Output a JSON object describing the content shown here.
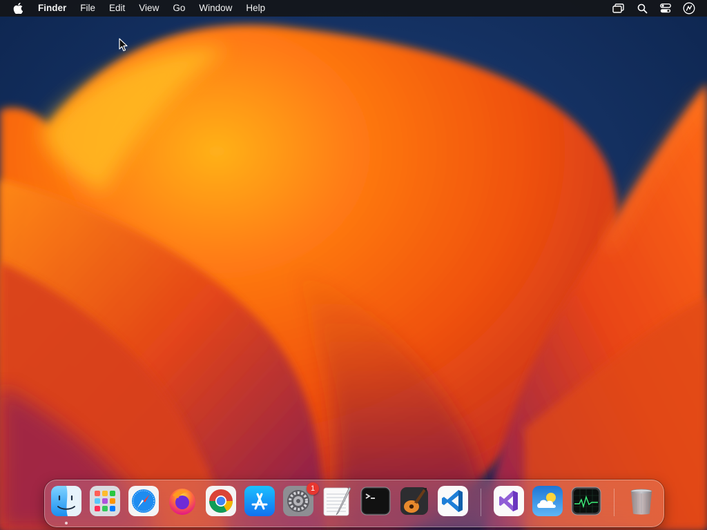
{
  "menubar": {
    "app_name": "Finder",
    "items": [
      "File",
      "Edit",
      "View",
      "Go",
      "Window",
      "Help"
    ],
    "status_icons": [
      "screen-mirroring-icon",
      "spotlight-search-icon",
      "control-center-icon",
      "siri-icon"
    ]
  },
  "wallpaper": {
    "name": "macOS Ventura",
    "colors": {
      "sky": "#0e2a55",
      "orange": "#f25a10",
      "yellow": "#ffb11a",
      "magenta": "#8d1f5a"
    }
  },
  "dock": {
    "apps": [
      {
        "name": "Finder",
        "icon": "finder-icon",
        "running": true
      },
      {
        "name": "Launchpad",
        "icon": "launchpad-icon"
      },
      {
        "name": "Safari",
        "icon": "safari-icon"
      },
      {
        "name": "Firefox",
        "icon": "firefox-icon"
      },
      {
        "name": "Google Chrome",
        "icon": "chrome-icon"
      },
      {
        "name": "App Store",
        "icon": "app-store-icon"
      },
      {
        "name": "System Settings",
        "icon": "system-settings-icon",
        "badge": "1"
      },
      {
        "name": "TextEdit",
        "icon": "textedit-icon"
      },
      {
        "name": "Terminal",
        "icon": "terminal-icon"
      },
      {
        "name": "GarageBand",
        "icon": "garageband-icon"
      },
      {
        "name": "Visual Studio Code",
        "icon": "vscode-icon"
      },
      {
        "name": "Visual Studio",
        "icon": "visual-studio-icon"
      },
      {
        "name": "Weather",
        "icon": "weather-icon"
      },
      {
        "name": "Activity Monitor",
        "icon": "activity-monitor-icon"
      },
      {
        "name": "Trash",
        "icon": "trash-icon"
      }
    ]
  }
}
